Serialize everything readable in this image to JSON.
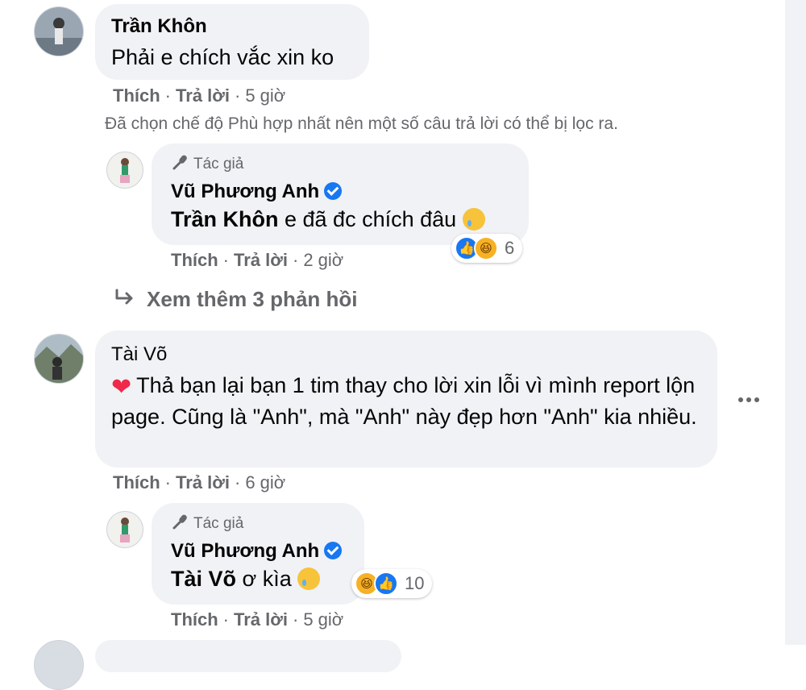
{
  "comment1": {
    "author": "Trần Khôn",
    "text": "Phải e chích vắc xin ko",
    "like": "Thích",
    "reply": "Trả lời",
    "time": "5 giờ"
  },
  "filter_notice": "Đã chọn chế độ Phù hợp nhất nên một số câu trả lời có thể bị lọc ra.",
  "reply1": {
    "author_tag": "Tác giả",
    "author": "Vũ Phương Anh",
    "mention": "Trần Khôn",
    "text": " e đã đc chích đâu",
    "like": "Thích",
    "reply": "Trả lời",
    "time": "2 giờ",
    "reaction_count": "6"
  },
  "more_replies": "Xem thêm 3 phản hồi",
  "comment2": {
    "author": "Tài Võ",
    "text": "Thả bạn lại bạn 1 tim thay cho lời xin lỗi vì mình report lộn page. Cũng là \"Anh\", mà \"Anh\" này đẹp hơn \"Anh\" kia nhiều.",
    "like": "Thích",
    "reply": "Trả lời",
    "time": "6 giờ"
  },
  "reply2": {
    "author_tag": "Tác giả",
    "author": "Vũ Phương Anh",
    "mention": "Tài Võ",
    "text": " ơ kìa",
    "like": "Thích",
    "reply": "Trả lời",
    "time": "5 giờ",
    "reaction_count": "10"
  },
  "icons": {
    "more": "more-options-icon",
    "verified": "verified-badge-icon",
    "reply_arrow": "reply-arrow-icon",
    "author": "microphone-icon"
  },
  "colors": {
    "bubble": "#f0f2f5",
    "secondary_text": "#65676b",
    "like_blue": "#1877f2",
    "heart_red": "#f0284a"
  }
}
